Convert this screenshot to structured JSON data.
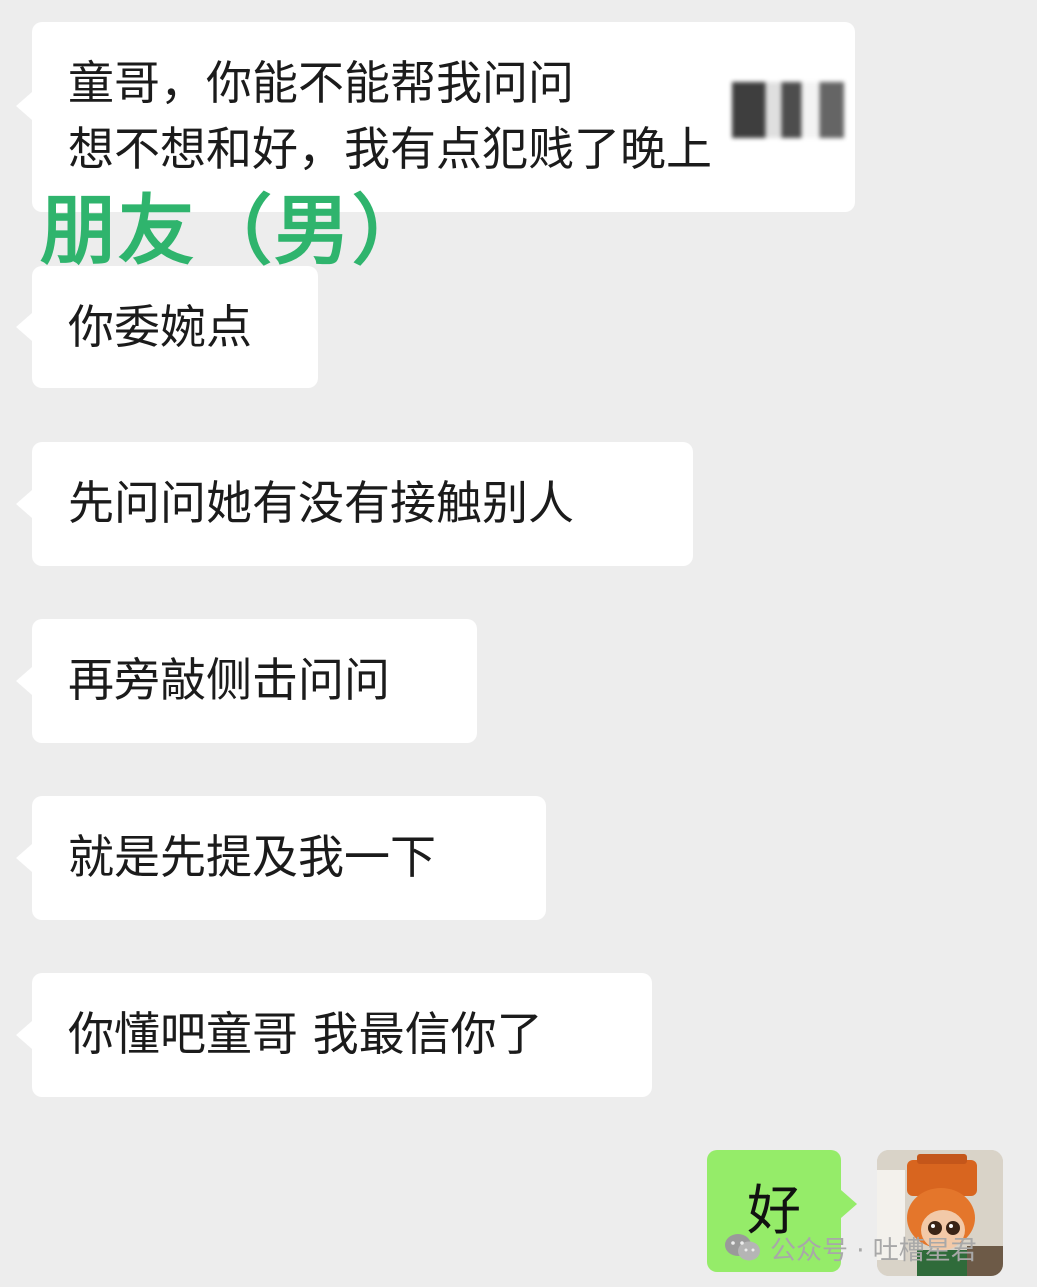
{
  "contact_label": "朋友（男）",
  "messages": [
    {
      "lines": [
        "童哥，你能不能帮我问问",
        "想不想和好，我有点犯贱了晚上"
      ]
    },
    {
      "lines": [
        "你委婉点"
      ]
    },
    {
      "lines": [
        "先问问她有没有接触别人"
      ]
    },
    {
      "lines": [
        "再旁敲侧击问问"
      ]
    },
    {
      "lines": [
        "就是先提及我一下"
      ]
    },
    {
      "lines": [
        "你懂吧童哥 我最信你了"
      ]
    }
  ],
  "my_reply": "好",
  "watermark": "公众号 · 吐槽星君",
  "colors": {
    "background": "#ededed",
    "incoming": "#ffffff",
    "outgoing": "#95ec69",
    "label": "#2fb46d"
  }
}
